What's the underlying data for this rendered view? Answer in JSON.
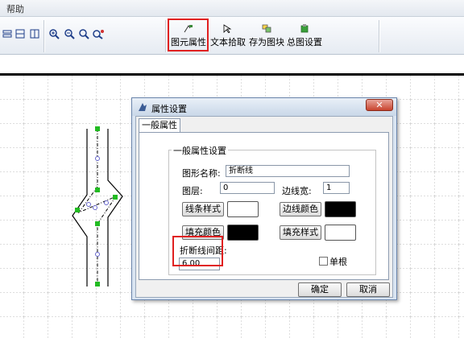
{
  "menubar": {
    "help": "帮助"
  },
  "toolbar": {
    "small_icons": [
      "layout-icon",
      "columns-icon",
      "panel-icon",
      "zoom-in-icon",
      "zoom-out-icon",
      "zoom-icon",
      "zoom-all-icon"
    ],
    "buttons": [
      {
        "label": "图元属性",
        "icon": "element-properties-icon"
      },
      {
        "label": "文本拾取",
        "icon": "text-pick-icon"
      },
      {
        "label": "存为图块",
        "icon": "save-block-icon"
      },
      {
        "label": "总图设置",
        "icon": "site-settings-icon"
      }
    ],
    "highlight_color": "#e02020"
  },
  "dialog": {
    "title": "属性设置",
    "close": "✕",
    "tab": "一般属性",
    "group_title": "一般属性设置",
    "name_label": "图形名称:",
    "name_value": "折断线",
    "layer_label": "图层:",
    "layer_value": "0",
    "width_label": "边线宽:",
    "width_value": "1",
    "line_style_button": "线条样式",
    "border_color_button": "边线颜色",
    "fill_color_button": "填充颜色",
    "fill_style_button": "填充样式",
    "line_style_swatch": "#ffffff",
    "border_color_swatch": "#000000",
    "fill_color_swatch": "#000000",
    "fill_style_swatch": "#ffffff",
    "break_spacing_label": "折断线间距:",
    "break_spacing_value": "6.00",
    "single_root_label": "单根",
    "single_root_checked": false,
    "ok_button": "确定",
    "cancel_button": "取消"
  }
}
